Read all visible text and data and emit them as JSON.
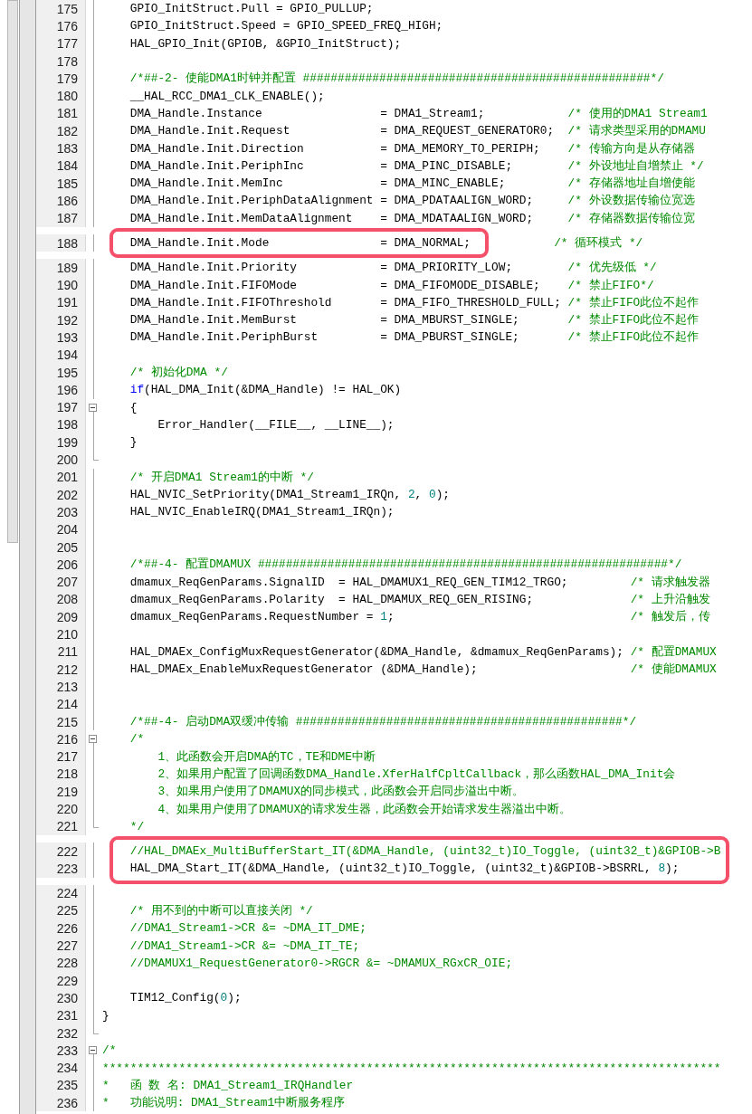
{
  "editor": {
    "lines": [
      {
        "number": "175",
        "collapsible": false,
        "fold_end": false,
        "highlighted": false,
        "segments": [
          {
            "kind": "plain",
            "text": "    GPIO_InitStruct.Pull = GPIO_PULLUP;"
          }
        ]
      },
      {
        "number": "176",
        "collapsible": false,
        "fold_end": false,
        "highlighted": false,
        "segments": [
          {
            "kind": "plain",
            "text": "    GPIO_InitStruct.Speed = GPIO_SPEED_FREQ_HIGH;"
          }
        ]
      },
      {
        "number": "177",
        "collapsible": false,
        "fold_end": false,
        "highlighted": false,
        "segments": [
          {
            "kind": "plain",
            "text": "    HAL_GPIO_Init(GPIOB, &GPIO_InitStruct);"
          }
        ]
      },
      {
        "number": "178",
        "collapsible": false,
        "fold_end": false,
        "highlighted": false
      },
      {
        "number": "179",
        "collapsible": false,
        "fold_end": false,
        "highlighted": false,
        "segments": [
          {
            "kind": "comment",
            "text": "    /*##-2- 使能DMA1时钟并配置 ##################################################*/"
          }
        ]
      },
      {
        "number": "180",
        "collapsible": false,
        "fold_end": false,
        "highlighted": false,
        "segments": [
          {
            "kind": "plain",
            "text": "    __HAL_RCC_DMA1_CLK_ENABLE();"
          }
        ]
      },
      {
        "number": "181",
        "collapsible": false,
        "fold_end": false,
        "highlighted": false,
        "segments": [
          {
            "kind": "plain",
            "text": "    DMA_Handle.Instance                 = DMA1_Stream1;            "
          },
          {
            "kind": "comment",
            "text": "/* 使用的DMA1 Stream1"
          }
        ]
      },
      {
        "number": "182",
        "collapsible": false,
        "fold_end": false,
        "highlighted": false,
        "segments": [
          {
            "kind": "plain",
            "text": "    DMA_Handle.Init.Request             = DMA_REQUEST_GENERATOR0;  "
          },
          {
            "kind": "comment",
            "text": "/* 请求类型采用的DMAMU"
          }
        ]
      },
      {
        "number": "183",
        "collapsible": false,
        "fold_end": false,
        "highlighted": false,
        "segments": [
          {
            "kind": "plain",
            "text": "    DMA_Handle.Init.Direction           = DMA_MEMORY_TO_PERIPH;    "
          },
          {
            "kind": "comment",
            "text": "/* 传输方向是从存储器"
          }
        ]
      },
      {
        "number": "184",
        "collapsible": false,
        "fold_end": false,
        "highlighted": false,
        "segments": [
          {
            "kind": "plain",
            "text": "    DMA_Handle.Init.PeriphInc           = DMA_PINC_DISABLE;        "
          },
          {
            "kind": "comment",
            "text": "/* 外设地址自增禁止 */"
          }
        ]
      },
      {
        "number": "185",
        "collapsible": false,
        "fold_end": false,
        "highlighted": false,
        "segments": [
          {
            "kind": "plain",
            "text": "    DMA_Handle.Init.MemInc              = DMA_MINC_ENABLE;         "
          },
          {
            "kind": "comment",
            "text": "/* 存储器地址自增使能"
          }
        ]
      },
      {
        "number": "186",
        "collapsible": false,
        "fold_end": false,
        "highlighted": false,
        "segments": [
          {
            "kind": "plain",
            "text": "    DMA_Handle.Init.PeriphDataAlignment = DMA_PDATAALIGN_WORD;     "
          },
          {
            "kind": "comment",
            "text": "/* 外设数据传输位宽选"
          }
        ]
      },
      {
        "number": "187",
        "collapsible": false,
        "fold_end": false,
        "highlighted": false,
        "segments": [
          {
            "kind": "plain",
            "text": "    DMA_Handle.Init.MemDataAlignment    = DMA_MDATAALIGN_WORD;     "
          },
          {
            "kind": "comment",
            "text": "/* 存储器数据传输位宽"
          }
        ]
      },
      {
        "number": "188",
        "collapsible": false,
        "fold_end": false,
        "highlighted": true,
        "segments": [
          {
            "kind": "plain",
            "text": "    DMA_Handle.Init.Mode                = DMA_NORMAL;            "
          },
          {
            "kind": "comment",
            "text": "/* 循环模式 */"
          }
        ]
      },
      {
        "number": "189",
        "collapsible": false,
        "fold_end": false,
        "highlighted": false,
        "segments": [
          {
            "kind": "plain",
            "text": "    DMA_Handle.Init.Priority            = DMA_PRIORITY_LOW;        "
          },
          {
            "kind": "comment",
            "text": "/* 优先级低 */"
          }
        ]
      },
      {
        "number": "190",
        "collapsible": false,
        "fold_end": false,
        "highlighted": false,
        "segments": [
          {
            "kind": "plain",
            "text": "    DMA_Handle.Init.FIFOMode            = DMA_FIFOMODE_DISABLE;    "
          },
          {
            "kind": "comment",
            "text": "/* 禁止FIFO*/"
          }
        ]
      },
      {
        "number": "191",
        "collapsible": false,
        "fold_end": false,
        "highlighted": false,
        "segments": [
          {
            "kind": "plain",
            "text": "    DMA_Handle.Init.FIFOThreshold       = DMA_FIFO_THRESHOLD_FULL; "
          },
          {
            "kind": "comment",
            "text": "/* 禁止FIFO此位不起作"
          }
        ]
      },
      {
        "number": "192",
        "collapsible": false,
        "fold_end": false,
        "highlighted": false,
        "segments": [
          {
            "kind": "plain",
            "text": "    DMA_Handle.Init.MemBurst            = DMA_MBURST_SINGLE;       "
          },
          {
            "kind": "comment",
            "text": "/* 禁止FIFO此位不起作"
          }
        ]
      },
      {
        "number": "193",
        "collapsible": false,
        "fold_end": false,
        "highlighted": false,
        "segments": [
          {
            "kind": "plain",
            "text": "    DMA_Handle.Init.PeriphBurst         = DMA_PBURST_SINGLE;       "
          },
          {
            "kind": "comment",
            "text": "/* 禁止FIFO此位不起作"
          }
        ]
      },
      {
        "number": "194",
        "collapsible": false,
        "fold_end": false,
        "highlighted": false
      },
      {
        "number": "195",
        "collapsible": false,
        "fold_end": false,
        "highlighted": false,
        "segments": [
          {
            "kind": "comment",
            "text": "    /* 初始化DMA */"
          }
        ]
      },
      {
        "number": "196",
        "collapsible": false,
        "fold_end": false,
        "highlighted": false,
        "segments": [
          {
            "kind": "keyword",
            "text": "    if"
          },
          {
            "kind": "plain",
            "text": "(HAL_DMA_Init(&DMA_Handle) != HAL_OK)"
          }
        ]
      },
      {
        "number": "197",
        "collapsible": true,
        "fold_end": false,
        "highlighted": false,
        "segments": [
          {
            "kind": "plain",
            "text": "    {"
          }
        ]
      },
      {
        "number": "198",
        "collapsible": false,
        "fold_end": false,
        "highlighted": false,
        "segments": [
          {
            "kind": "plain",
            "text": "        Error_Handler(__FILE__, __LINE__);"
          }
        ]
      },
      {
        "number": "199",
        "collapsible": false,
        "fold_end": false,
        "highlighted": false,
        "segments": [
          {
            "kind": "plain",
            "text": "    }"
          }
        ]
      },
      {
        "number": "200",
        "collapsible": false,
        "fold_end": true,
        "highlighted": false
      },
      {
        "number": "201",
        "collapsible": false,
        "fold_end": false,
        "highlighted": false,
        "segments": [
          {
            "kind": "comment",
            "text": "    /* 开启DMA1 Stream1的中断 */"
          }
        ]
      },
      {
        "number": "202",
        "collapsible": false,
        "fold_end": false,
        "highlighted": false,
        "segments": [
          {
            "kind": "plain",
            "text": "    HAL_NVIC_SetPriority(DMA1_Stream1_IRQn, "
          },
          {
            "kind": "number",
            "text": "2"
          },
          {
            "kind": "plain",
            "text": ", "
          },
          {
            "kind": "number",
            "text": "0"
          },
          {
            "kind": "plain",
            "text": ");"
          }
        ]
      },
      {
        "number": "203",
        "collapsible": false,
        "fold_end": false,
        "highlighted": false,
        "segments": [
          {
            "kind": "plain",
            "text": "    HAL_NVIC_EnableIRQ(DMA1_Stream1_IRQn);"
          }
        ]
      },
      {
        "number": "204",
        "collapsible": false,
        "fold_end": false,
        "highlighted": false
      },
      {
        "number": "205",
        "collapsible": false,
        "fold_end": false,
        "highlighted": false
      },
      {
        "number": "206",
        "collapsible": false,
        "fold_end": false,
        "highlighted": false,
        "segments": [
          {
            "kind": "comment",
            "text": "    /*##-4- 配置DMAMUX ###########################################################*/"
          }
        ]
      },
      {
        "number": "207",
        "collapsible": false,
        "fold_end": false,
        "highlighted": false,
        "segments": [
          {
            "kind": "plain",
            "text": "    dmamux_ReqGenParams.SignalID  = HAL_DMAMUX1_REQ_GEN_TIM12_TRGO;         "
          },
          {
            "kind": "comment",
            "text": "/* 请求触发器"
          }
        ]
      },
      {
        "number": "208",
        "collapsible": false,
        "fold_end": false,
        "highlighted": false,
        "segments": [
          {
            "kind": "plain",
            "text": "    dmamux_ReqGenParams.Polarity  = HAL_DMAMUX_REQ_GEN_RISING;              "
          },
          {
            "kind": "comment",
            "text": "/* 上升沿触发"
          }
        ]
      },
      {
        "number": "209",
        "collapsible": false,
        "fold_end": false,
        "highlighted": false,
        "segments": [
          {
            "kind": "plain",
            "text": "    dmamux_ReqGenParams.RequestNumber = "
          },
          {
            "kind": "number",
            "text": "1"
          },
          {
            "kind": "plain",
            "text": ";                                  "
          },
          {
            "kind": "comment",
            "text": "/* 触发后，传"
          }
        ]
      },
      {
        "number": "210",
        "collapsible": false,
        "fold_end": false,
        "highlighted": false
      },
      {
        "number": "211",
        "collapsible": false,
        "fold_end": false,
        "highlighted": false,
        "segments": [
          {
            "kind": "plain",
            "text": "    HAL_DMAEx_ConfigMuxRequestGenerator(&DMA_Handle, &dmamux_ReqGenParams); "
          },
          {
            "kind": "comment",
            "text": "/* 配置DMAMUX"
          }
        ]
      },
      {
        "number": "212",
        "collapsible": false,
        "fold_end": false,
        "highlighted": false,
        "segments": [
          {
            "kind": "plain",
            "text": "    HAL_DMAEx_EnableMuxRequestGenerator (&DMA_Handle);                      "
          },
          {
            "kind": "comment",
            "text": "/* 使能DMAMUX"
          }
        ]
      },
      {
        "number": "213",
        "collapsible": false,
        "fold_end": false,
        "highlighted": false
      },
      {
        "number": "214",
        "collapsible": false,
        "fold_end": false,
        "highlighted": false
      },
      {
        "number": "215",
        "collapsible": false,
        "fold_end": false,
        "highlighted": false,
        "segments": [
          {
            "kind": "comment",
            "text": "    /*##-4- 启动DMA双缓冲传输 ###############################################*/"
          }
        ]
      },
      {
        "number": "216",
        "collapsible": true,
        "fold_end": false,
        "highlighted": false,
        "segments": [
          {
            "kind": "comment",
            "text": "    /*"
          }
        ]
      },
      {
        "number": "217",
        "collapsible": false,
        "fold_end": false,
        "highlighted": false,
        "segments": [
          {
            "kind": "comment",
            "text": "        1、此函数会开启DMA的TC，TE和DME中断"
          }
        ]
      },
      {
        "number": "218",
        "collapsible": false,
        "fold_end": false,
        "highlighted": false,
        "segments": [
          {
            "kind": "comment",
            "text": "        2、如果用户配置了回调函数DMA_Handle.XferHalfCpltCallback，那么函数HAL_DMA_Init会"
          }
        ]
      },
      {
        "number": "219",
        "collapsible": false,
        "fold_end": false,
        "highlighted": false,
        "segments": [
          {
            "kind": "comment",
            "text": "        3、如果用户使用了DMAMUX的同步模式，此函数会开启同步溢出中断。"
          }
        ]
      },
      {
        "number": "220",
        "collapsible": false,
        "fold_end": false,
        "highlighted": false,
        "segments": [
          {
            "kind": "comment",
            "text": "        4、如果用户使用了DMAMUX的请求发生器，此函数会开始请求发生器溢出中断。"
          }
        ]
      },
      {
        "number": "221",
        "collapsible": false,
        "fold_end": true,
        "highlighted": false,
        "segments": [
          {
            "kind": "comment",
            "text": "    */"
          }
        ]
      },
      {
        "number": "222",
        "collapsible": false,
        "fold_end": false,
        "highlighted": true,
        "segments": [
          {
            "kind": "comment",
            "text": "    //HAL_DMAEx_MultiBufferStart_IT(&DMA_Handle, (uint32_t)IO_Toggle, (uint32_t)&GPIOB->B"
          }
        ]
      },
      {
        "number": "223",
        "collapsible": false,
        "fold_end": false,
        "highlighted": true,
        "segments": [
          {
            "kind": "plain",
            "text": "    HAL_DMA_Start_IT(&DMA_Handle, (uint32_t)IO_Toggle, (uint32_t)&GPIOB->BSRRL, "
          },
          {
            "kind": "number",
            "text": "8"
          },
          {
            "kind": "plain",
            "text": ");"
          }
        ]
      },
      {
        "number": "224",
        "collapsible": false,
        "fold_end": false,
        "highlighted": false
      },
      {
        "number": "225",
        "collapsible": false,
        "fold_end": false,
        "highlighted": false,
        "segments": [
          {
            "kind": "comment",
            "text": "    /* 用不到的中断可以直接关闭 */"
          }
        ]
      },
      {
        "number": "226",
        "collapsible": false,
        "fold_end": false,
        "highlighted": false,
        "segments": [
          {
            "kind": "comment",
            "text": "    //DMA1_Stream1->CR &= ~DMA_IT_DME;"
          }
        ]
      },
      {
        "number": "227",
        "collapsible": false,
        "fold_end": false,
        "highlighted": false,
        "segments": [
          {
            "kind": "comment",
            "text": "    //DMA1_Stream1->CR &= ~DMA_IT_TE;"
          }
        ]
      },
      {
        "number": "228",
        "collapsible": false,
        "fold_end": false,
        "highlighted": false,
        "segments": [
          {
            "kind": "comment",
            "text": "    //DMAMUX1_RequestGenerator0->RGCR &= ~DMAMUX_RGxCR_OIE;"
          }
        ]
      },
      {
        "number": "229",
        "collapsible": false,
        "fold_end": false,
        "highlighted": false
      },
      {
        "number": "230",
        "collapsible": false,
        "fold_end": false,
        "highlighted": false,
        "segments": [
          {
            "kind": "plain",
            "text": "    TIM12_Config("
          },
          {
            "kind": "number",
            "text": "0"
          },
          {
            "kind": "plain",
            "text": ");"
          }
        ]
      },
      {
        "number": "231",
        "collapsible": false,
        "fold_end": false,
        "highlighted": false,
        "segments": [
          {
            "kind": "plain",
            "text": "}"
          }
        ]
      },
      {
        "number": "232",
        "collapsible": false,
        "fold_end": true,
        "highlighted": false
      },
      {
        "number": "233",
        "collapsible": true,
        "fold_end": false,
        "highlighted": false,
        "segments": [
          {
            "kind": "comment",
            "text": "/*"
          }
        ]
      },
      {
        "number": "234",
        "collapsible": false,
        "fold_end": false,
        "highlighted": false,
        "segments": [
          {
            "kind": "comment",
            "text": "*****************************************************************************************"
          }
        ]
      },
      {
        "number": "235",
        "collapsible": false,
        "fold_end": false,
        "highlighted": false,
        "segments": [
          {
            "kind": "comment",
            "text": "*   函 数 名: DMA1_Stream1_IRQHandler"
          }
        ]
      },
      {
        "number": "236",
        "collapsible": false,
        "fold_end": false,
        "highlighted": false,
        "segments": [
          {
            "kind": "comment",
            "text": "*   功能说明: DMA1_Stream1中断服务程序"
          }
        ]
      }
    ]
  }
}
